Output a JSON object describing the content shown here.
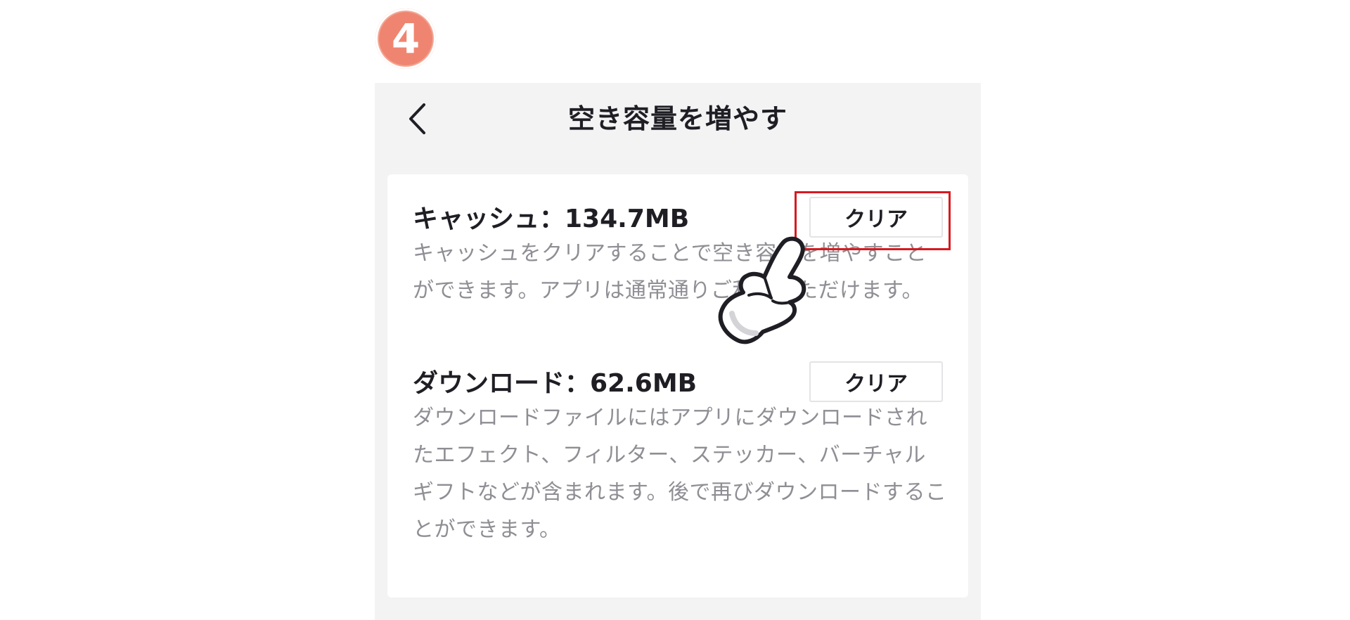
{
  "step_badge": "4",
  "nav": {
    "title": "空き容量を増やす",
    "back_icon": "chevron-left-icon"
  },
  "sections": [
    {
      "title": "キャッシュ：134.7MB",
      "button_label": "クリア",
      "description": "キャッシュをクリアすることで空き容量を増やすことができます。アプリは通常通りご利用いただけます。"
    },
    {
      "title": "ダウンロード：62.6MB",
      "button_label": "クリア",
      "description": "ダウンロードファイルにはアプリにダウンロードされたエフェクト、フィルター、ステッカー、バーチャルギフトなどが含まれます。後で再びダウンロードすることができます。"
    }
  ],
  "overlay": {
    "pointer_icon": "pointing-hand-icon",
    "highlight_color": "#d71920"
  },
  "colors": {
    "badge": "#ef8570",
    "background": "#f3f3f4",
    "card": "#ffffff",
    "title_text": "#1e1e24",
    "desc_text": "#8e8e94"
  }
}
